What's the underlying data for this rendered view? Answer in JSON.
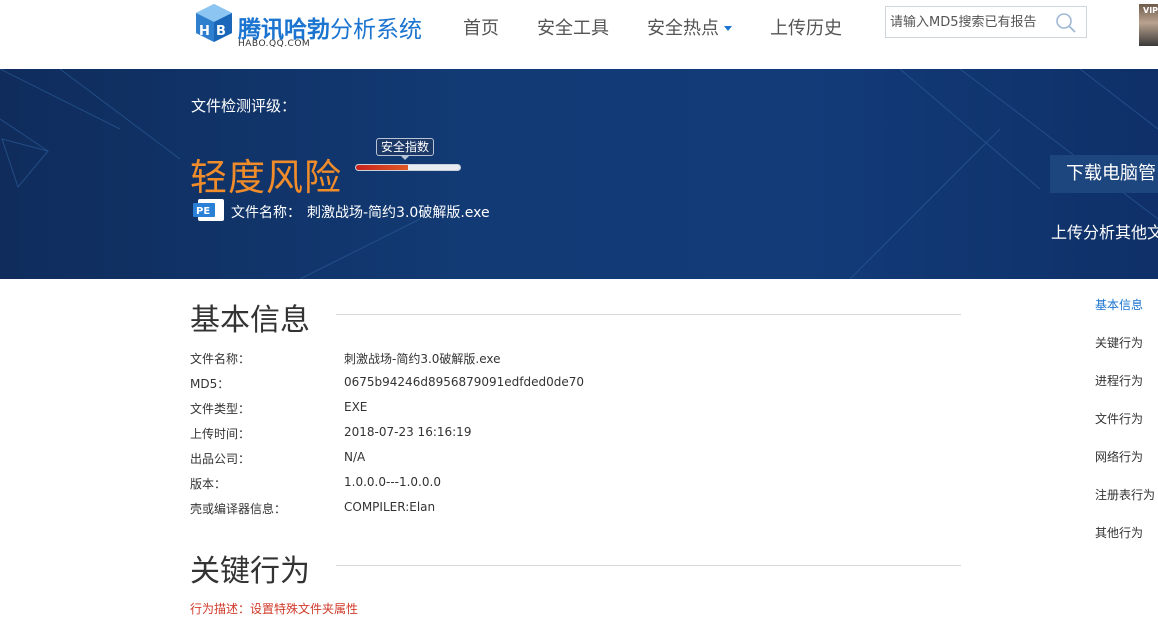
{
  "header": {
    "logo_title_bold": "腾讯哈勃",
    "logo_title_rest": "分析系统",
    "logo_subtitle": "HABO.QQ.COM",
    "nav": [
      {
        "label": "首页",
        "has_dropdown": false
      },
      {
        "label": "安全工具",
        "has_dropdown": false
      },
      {
        "label": "安全热点",
        "has_dropdown": true
      },
      {
        "label": "上传历史",
        "has_dropdown": false
      }
    ],
    "search_placeholder": "请输入MD5搜索已有报告",
    "avatar_badge": "VIP"
  },
  "banner": {
    "rating_label": "文件检测评级：",
    "rating_level": "轻度风险",
    "safety_index_label": "安全指数",
    "safety_index_fraction": 0.5,
    "file_name_label": "文件名称：",
    "file_name": "刺激战场-简约3.0破解版.exe",
    "download_button": "下载电脑管",
    "upload_other": "上传分析其他文"
  },
  "basic_info": {
    "title": "基本信息",
    "rows": [
      {
        "key": "文件名称：",
        "value": "刺激战场-简约3.0破解版.exe"
      },
      {
        "key": "MD5：",
        "value": "0675b94246d8956879091edfded0de70"
      },
      {
        "key": "文件类型：",
        "value": "EXE"
      },
      {
        "key": "上传时间：",
        "value": "2018-07-23 16:16:19"
      },
      {
        "key": "出品公司：",
        "value": "N/A"
      },
      {
        "key": "版本：",
        "value": "1.0.0.0---1.0.0.0"
      },
      {
        "key": "壳或编译器信息：",
        "value": "COMPILER:Elan"
      }
    ]
  },
  "key_behavior": {
    "title": "关键行为",
    "desc": "行为描述：设置特殊文件夹属性"
  },
  "side_nav": [
    {
      "label": "基本信息",
      "active": true
    },
    {
      "label": "关键行为",
      "active": false
    },
    {
      "label": "进程行为",
      "active": false
    },
    {
      "label": "文件行为",
      "active": false
    },
    {
      "label": "网络行为",
      "active": false
    },
    {
      "label": "注册表行为",
      "active": false
    },
    {
      "label": "其他行为",
      "active": false
    }
  ],
  "colors": {
    "brand_blue": "#1a74d0",
    "banner_navy": "#123a74",
    "risk_orange": "#f08c2a",
    "meter_red": "#c8211d"
  }
}
